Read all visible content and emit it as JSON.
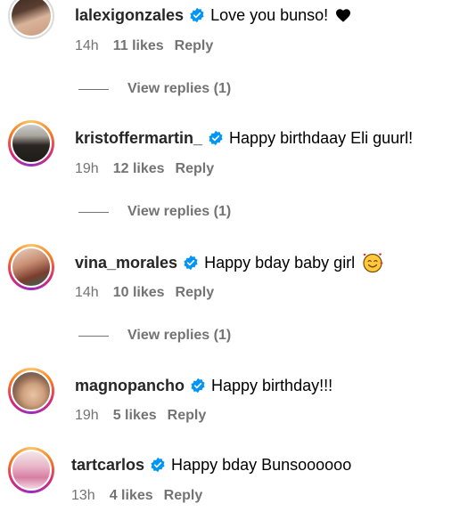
{
  "comments": [
    {
      "username": "lalexigonzales",
      "text": "Love you bunso!",
      "emoji": "heart",
      "time": "14h",
      "likes": "11 likes",
      "reply": "Reply",
      "view_replies": "View replies (1)",
      "avatar": "plain"
    },
    {
      "username": "kristoffermartin_",
      "text": "Happy birthdaay Eli guurl!",
      "time": "19h",
      "likes": "12 likes",
      "reply": "Reply",
      "view_replies": "View replies (1)",
      "avatar": "story"
    },
    {
      "username": "vina_morales",
      "text": "Happy bday baby girl",
      "emoji": "smiling-face-with-hearts",
      "time": "14h",
      "likes": "10 likes",
      "reply": "Reply",
      "view_replies": "View replies (1)",
      "avatar": "story"
    },
    {
      "username": "magnopancho",
      "text": "Happy birthday!!!",
      "time": "19h",
      "likes": "5 likes",
      "reply": "Reply",
      "avatar": "story"
    },
    {
      "username": "tartcarlos",
      "text": "Happy bday Bunsoooooo",
      "time": "13h",
      "likes": "4 likes",
      "reply": "Reply",
      "avatar": "story"
    }
  ],
  "colors": {
    "verified": "#0095f6",
    "muted": "#737373",
    "story_ring": [
      "#fdc468",
      "#fa7e1e",
      "#d62976",
      "#962fbf"
    ]
  }
}
